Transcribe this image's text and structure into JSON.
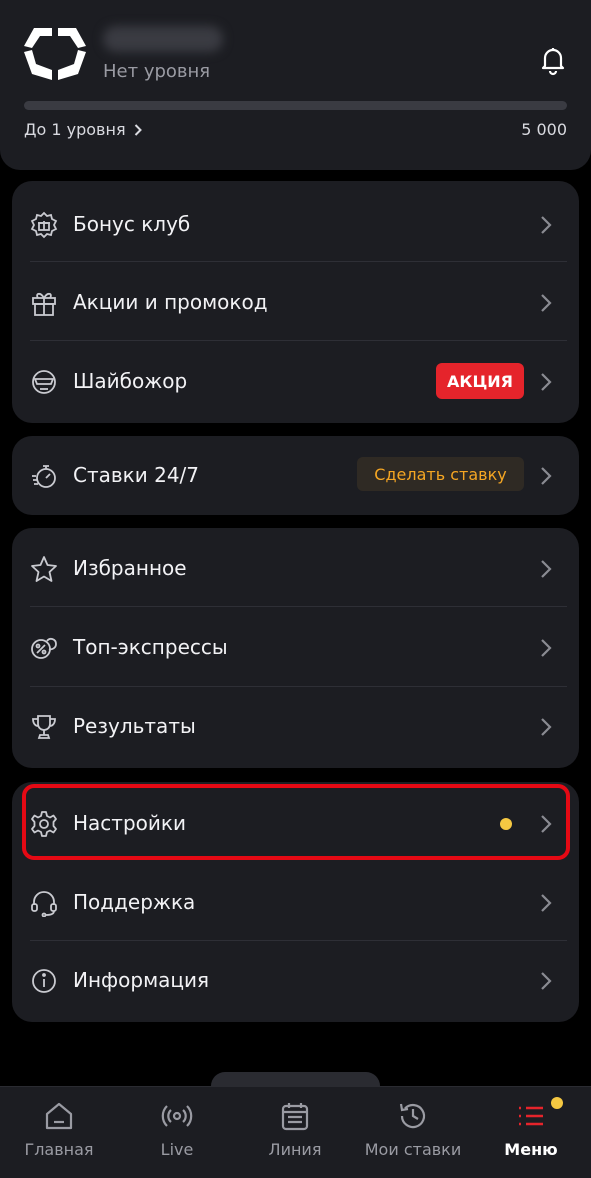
{
  "header": {
    "level_text": "Нет уровня",
    "progress_fraction": 0,
    "level_link": "До 1 уровня",
    "points": "5 000"
  },
  "menu": {
    "group1": [
      {
        "label": "Бонус клуб",
        "icon": "bonus-club-icon"
      },
      {
        "label": "Акции и промокод",
        "icon": "gift-icon"
      },
      {
        "label": "Шайбожор",
        "icon": "mask-icon",
        "badge": "АКЦИЯ"
      }
    ],
    "group2": [
      {
        "label": "Ставки 24/7",
        "icon": "stopwatch-icon",
        "badge": "Сделать ставку"
      }
    ],
    "group3": [
      {
        "label": "Избранное",
        "icon": "star-icon"
      },
      {
        "label": "Топ-экспрессы",
        "icon": "top-express-icon"
      },
      {
        "label": "Результаты",
        "icon": "trophy-icon"
      }
    ],
    "group4": [
      {
        "label": "Настройки",
        "icon": "gear-icon",
        "has_notification_dot": true
      },
      {
        "label": "Поддержка",
        "icon": "headset-icon"
      },
      {
        "label": "Информация",
        "icon": "info-icon"
      }
    ]
  },
  "tabs": [
    {
      "label": "Главная",
      "icon": "home-icon"
    },
    {
      "label": "Live",
      "icon": "live-broadcast-icon"
    },
    {
      "label": "Линия",
      "icon": "calendar-icon"
    },
    {
      "label": "Мои ставки",
      "icon": "history-icon"
    },
    {
      "label": "Меню",
      "icon": "menu-list-icon",
      "active": true
    }
  ],
  "colors": {
    "background": "#000000",
    "card": "#1c1d22",
    "accent_red": "#e5242b",
    "accent_orange": "#f5a623",
    "notification_yellow": "#f5c842",
    "highlight_border": "#e50914"
  }
}
